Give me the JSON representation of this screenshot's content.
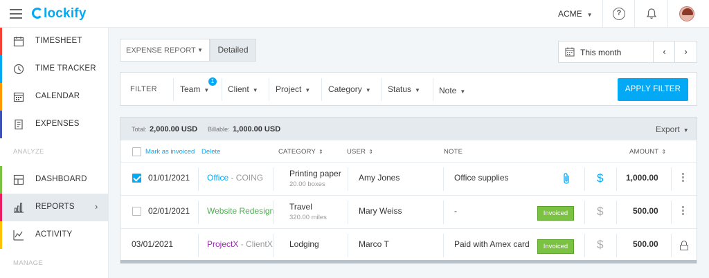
{
  "app": {
    "name": "Clockify",
    "workspace": "ACME"
  },
  "sidebar": {
    "items": [
      {
        "label": "TIMESHEET",
        "icon": "timesheet-icon",
        "color": "#f44336"
      },
      {
        "label": "TIME TRACKER",
        "icon": "clock-icon",
        "color": "#03a9f4"
      },
      {
        "label": "CALENDAR",
        "icon": "calendar-icon",
        "color": "#ff9800"
      },
      {
        "label": "EXPENSES",
        "icon": "expenses-icon",
        "color": "#3f51b5"
      }
    ],
    "analyze_label": "ANALYZE",
    "analyze_items": [
      {
        "label": "DASHBOARD",
        "icon": "dashboard-icon",
        "color": "#7cc242"
      },
      {
        "label": "REPORTS",
        "icon": "bar-chart-icon",
        "color": "#e91e63",
        "active": true
      },
      {
        "label": "ACTIVITY",
        "icon": "activity-icon",
        "color": "#ffc107"
      }
    ],
    "manage_label": "MANAGE"
  },
  "report": {
    "type_select": "EXPENSE REPORT",
    "mode": "Detailed",
    "date_range": "This month"
  },
  "filter": {
    "label": "FILTER",
    "items": [
      "Team",
      "Client",
      "Project",
      "Category",
      "Status",
      "Note"
    ],
    "team_badge": "1",
    "apply_label": "APPLY FILTER"
  },
  "summary": {
    "total_label": "Total:",
    "total_value": "2,000.00 USD",
    "billable_label": "Billable:",
    "billable_value": "1,000.00 USD",
    "export_label": "Export"
  },
  "table": {
    "bulk_actions": {
      "mark_invoiced": "Mark as invoiced",
      "delete": "Delete"
    },
    "columns": {
      "category": "CATEGORY",
      "user": "USER",
      "note": "NOTE",
      "amount": "AMOUNT"
    },
    "rows": [
      {
        "checked": true,
        "date": "01/01/2021",
        "project": "Office",
        "client": " - COING",
        "project_color": "#03a9f4",
        "category": "Printing paper",
        "quantity": "20.00 boxes",
        "user": "Amy Jones",
        "note": "Office supplies",
        "invoiced": "",
        "billable": true,
        "amount": "1,000.00"
      },
      {
        "checked": false,
        "date": "02/01/2021",
        "project": "Website Redesign",
        "client": "",
        "project_color": "#4caf50",
        "category": "Travel",
        "quantity": "320.00 miles",
        "user": "Mary Weiss",
        "note": "-",
        "invoiced": "Invoiced",
        "billable": false,
        "amount": "500.00"
      },
      {
        "locked": true,
        "date": "03/01/2021",
        "project": "ProjectX",
        "client": " - ClientX",
        "project_color": "#9c27b0",
        "category": "Lodging",
        "quantity": "",
        "user": "Marco T",
        "note": "Paid with Amex card",
        "invoiced": "Invoiced",
        "billable": false,
        "amount": "500.00"
      }
    ]
  }
}
